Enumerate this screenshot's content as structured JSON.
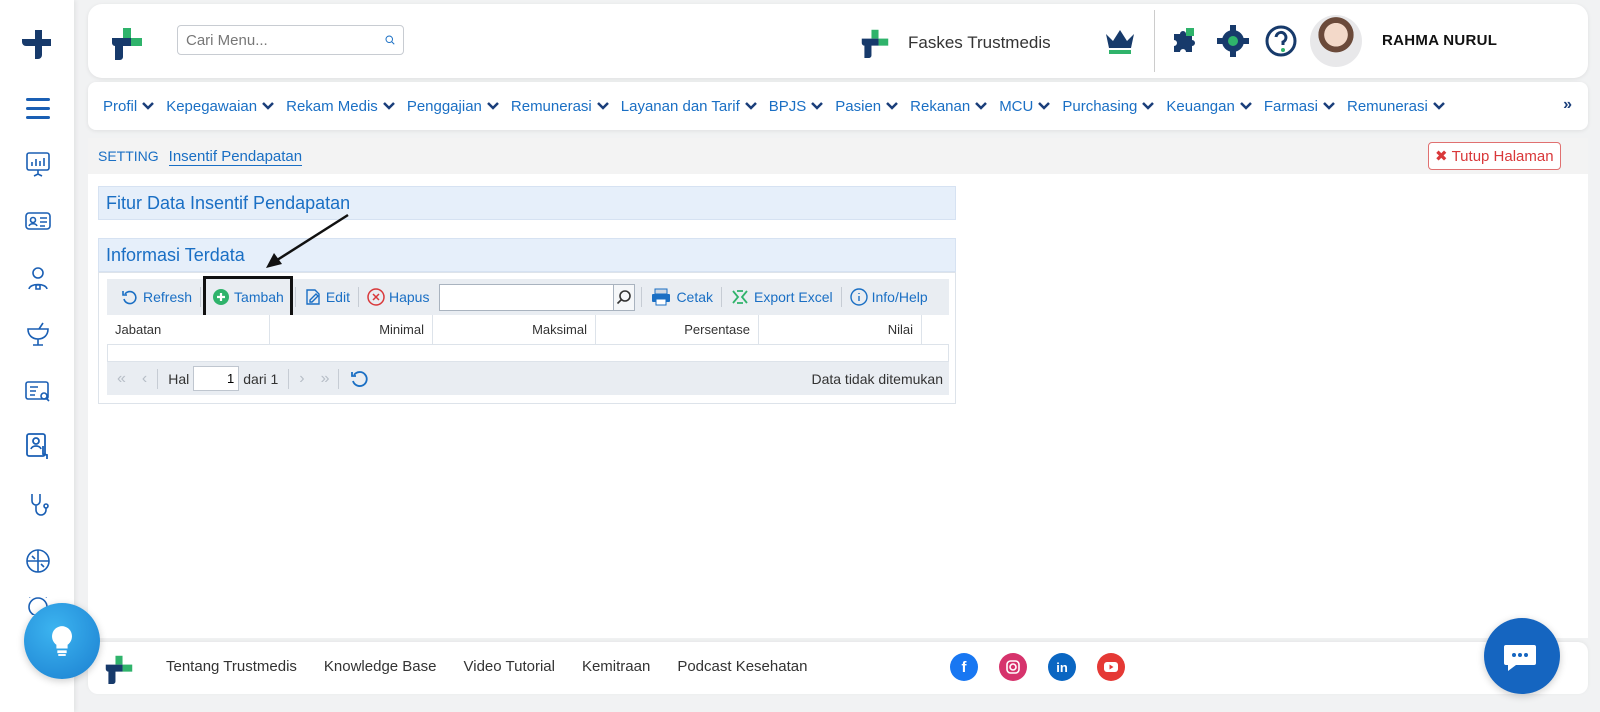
{
  "search": {
    "placeholder": "Cari Menu..."
  },
  "header": {
    "facility_name": "Faskes Trustmedis",
    "user_name": "RAHMA NURUL"
  },
  "menu": {
    "items": [
      "Profil",
      "Kepegawaian",
      "Rekam Medis",
      "Penggajian",
      "Remunerasi",
      "Layanan dan Tarif",
      "BPJS",
      "Pasien",
      "Rekanan",
      "MCU",
      "Purchasing",
      "Keuangan",
      "Farmasi",
      "Remunerasi"
    ],
    "more_label": "»"
  },
  "breadcrumb": {
    "root": "SETTING",
    "current": "Insentif Pendapatan"
  },
  "close_label": "Tutup Halaman",
  "sections": {
    "feature_title": "Fitur Data Insentif Pendapatan",
    "info_title": "Informasi Terdata"
  },
  "toolbar": {
    "refresh": "Refresh",
    "add": "Tambah",
    "edit": "Edit",
    "delete": "Hapus",
    "print": "Cetak",
    "export": "Export Excel",
    "help": "Info/Help"
  },
  "table": {
    "columns": [
      "Jabatan",
      "Minimal",
      "Maksimal",
      "Persentase",
      "Nilai"
    ]
  },
  "pager": {
    "page_label": "Hal",
    "page_value": "1",
    "of_label": "dari 1",
    "empty_message": "Data tidak ditemukan"
  },
  "footer": {
    "links": [
      "Tentang Trustmedis",
      "Knowledge Base",
      "Video Tutorial",
      "Kemitraan",
      "Podcast Kesehatan"
    ]
  },
  "colors": {
    "primary_blue": "#1a6fc4",
    "brand_green": "#2fb36b",
    "brand_navy": "#173a6b",
    "danger": "#d9383a"
  }
}
